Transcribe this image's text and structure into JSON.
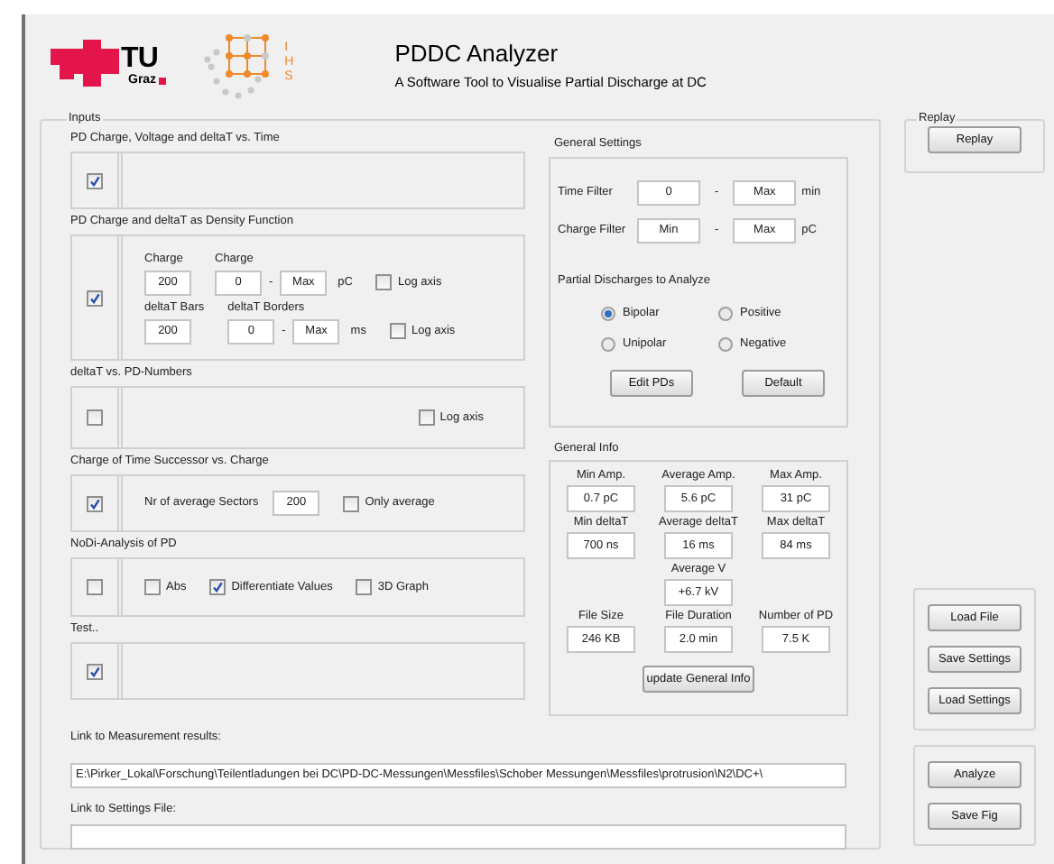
{
  "header": {
    "logo_tu": {
      "letters": "TU",
      "city": "Graz"
    },
    "logo_ihs": {
      "letters": "IHS"
    },
    "title": "PDDC Analyzer",
    "subtitle": "A Software Tool to Visualise Partial Discharge at DC"
  },
  "inputs": {
    "title": "Inputs",
    "sections": [
      {
        "title": "PD Charge, Voltage and deltaT vs. Time",
        "checked": true
      },
      {
        "title": "PD Charge and deltaT as Density Function",
        "checked": true,
        "rows": [
          [
            {
              "kind": "stacked_field",
              "label": "Charge",
              "value": "200"
            },
            {
              "kind": "range",
              "label": "Charge",
              "from": "0",
              "separator": "-",
              "to": "Max",
              "unit": "pC"
            },
            {
              "kind": "checkbox",
              "label": "Log axis",
              "checked": false
            }
          ],
          [
            {
              "kind": "stacked_field",
              "label": "deltaT Bars",
              "value": "200"
            },
            {
              "kind": "range",
              "label": "deltaT Borders",
              "from": "0",
              "separator": "-",
              "to": "Max",
              "unit": "ms"
            },
            {
              "kind": "checkbox",
              "label": "Log axis",
              "checked": false
            }
          ]
        ]
      },
      {
        "title": "deltaT vs. PD-Numbers",
        "checked": false,
        "rows": [
          [
            {
              "kind": "checkbox",
              "label": "Log axis",
              "checked": false
            }
          ]
        ]
      },
      {
        "title": "Charge of Time Successor vs. Charge",
        "checked": true,
        "rows": [
          [
            {
              "kind": "inline_field",
              "label": "Nr of average Sectors",
              "value": "200"
            },
            {
              "kind": "checkbox",
              "label": "Only average",
              "checked": false
            }
          ]
        ]
      },
      {
        "title": "NoDi-Analysis of PD",
        "checked": false,
        "rows": [
          [
            {
              "kind": "checkbox",
              "label": "Abs",
              "checked": false
            },
            {
              "kind": "checkbox",
              "label": "Differentiate Values",
              "checked": true
            },
            {
              "kind": "checkbox",
              "label": "3D Graph",
              "checked": false
            }
          ]
        ]
      },
      {
        "title": "Test..",
        "checked": true
      }
    ],
    "general_settings": {
      "title": "General Settings",
      "filters": [
        {
          "label": "Time Filter",
          "from": "0",
          "separator": "-",
          "to": "Max",
          "unit": "min"
        },
        {
          "label": "Charge Filter",
          "from": "Min",
          "separator": "-",
          "to": "Max",
          "unit": "pC"
        }
      ],
      "radio_title": "Partial Discharges to Analyze",
      "radios": [
        {
          "label": "Bipolar",
          "selected": true
        },
        {
          "label": "Positive",
          "selected": false
        },
        {
          "label": "Unipolar",
          "selected": false
        },
        {
          "label": "Negative",
          "selected": false
        }
      ],
      "buttons": [
        "Edit PDs",
        "Default"
      ]
    },
    "general_info": {
      "title": "General Info",
      "rows": [
        [
          {
            "label": "Min Amp.",
            "value": "0.7 pC"
          },
          {
            "label": "Average Amp.",
            "value": "5.6 pC"
          },
          {
            "label": "Max Amp.",
            "value": "31 pC"
          }
        ],
        [
          {
            "label": "Min deltaT",
            "value": "700 ns"
          },
          {
            "label": "Average deltaT",
            "value": "16 ms"
          },
          {
            "label": "Max deltaT",
            "value": "84 ms"
          }
        ],
        [
          "",
          {
            "label": "Average V",
            "value": "+6.7 kV"
          },
          ""
        ],
        [
          {
            "label": "File Size",
            "value": "246 KB"
          },
          {
            "label": "File Duration",
            "value": "2.0 min"
          },
          {
            "label": "Number of PD",
            "value": "7.5 K"
          }
        ]
      ],
      "button": "update General Info"
    },
    "links": [
      {
        "label": "Link to Measurement results:",
        "value": "E:\\Pirker_Lokal\\Forschung\\Teilentladungen bei DC\\PD-DC-Messungen\\Messfiles\\Schober Messungen\\Messfiles\\protrusion\\N2\\DC+\\"
      },
      {
        "label": "Link to Settings File:"
      }
    ]
  },
  "replay": {
    "title": "Replay",
    "button": "Replay"
  },
  "file_buttons": [
    "Load File",
    "Save Settings",
    "Load Settings"
  ],
  "figure_buttons": [
    "Analyze",
    "Save Fig"
  ]
}
